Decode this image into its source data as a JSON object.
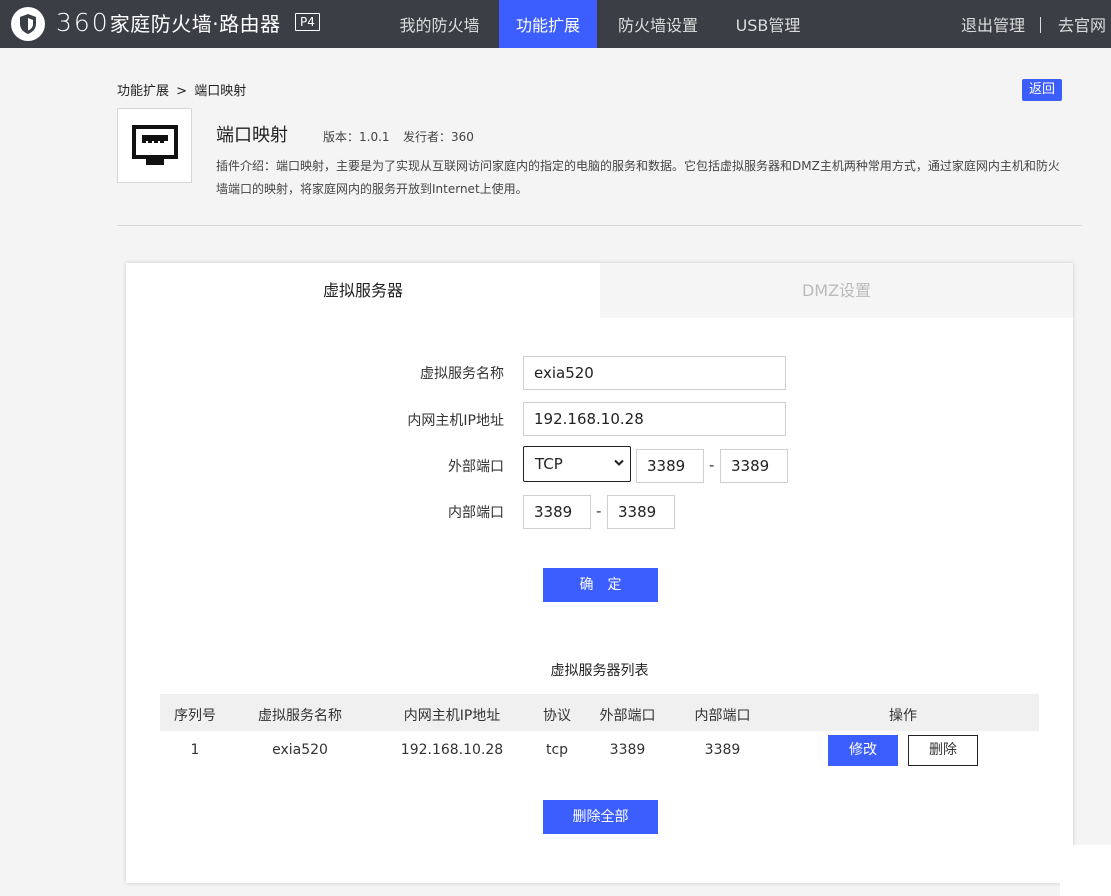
{
  "brand": {
    "number": "360",
    "title": "家庭防火墙·路由器",
    "badge": "P4"
  },
  "nav": {
    "items": [
      "我的防火墙",
      "功能扩展",
      "防火墙设置",
      "USB管理"
    ],
    "active_index": 1,
    "logout": "退出管理",
    "official": "去官网"
  },
  "breadcrumb": {
    "parent": "功能扩展",
    "sep": ">",
    "current": "端口映射"
  },
  "back_label": "返回",
  "plugin": {
    "name": "端口映射",
    "version": "版本：1.0.1",
    "publisher": "发行者：360",
    "description": "插件介绍：端口映射，主要是为了实现从互联网访问家庭内的指定的电脑的服务和数据。它包括虚拟服务器和DMZ主机两种常用方式，通过家庭网内主机和防火墙端口的映射，将家庭网内的服务开放到Internet上使用。"
  },
  "tabs": [
    "虚拟服务器",
    "DMZ设置"
  ],
  "form": {
    "name_label": "虚拟服务名称",
    "name_value": "exia520",
    "ip_label": "内网主机IP地址",
    "ip_value": "192.168.10.28",
    "ext_port_label": "外部端口",
    "protocol": "TCP",
    "ext_port_start": "3389",
    "ext_port_end": "3389",
    "int_port_label": "内部端口",
    "int_port_start": "3389",
    "int_port_end": "3389",
    "dash": "-",
    "confirm": "确　定"
  },
  "list": {
    "title": "虚拟服务器列表",
    "headers": [
      "序列号",
      "虚拟服务名称",
      "内网主机IP地址",
      "协议",
      "外部端口",
      "内部端口",
      "操作"
    ],
    "rows": [
      {
        "index": "1",
        "name": "exia520",
        "ip": "192.168.10.28",
        "protocol": "tcp",
        "ext_port": "3389",
        "int_port": "3389"
      }
    ],
    "edit": "修改",
    "delete": "删除",
    "delete_all": "删除全部"
  },
  "colors": {
    "topbar": "#3b3f45",
    "accent": "#3d5eff",
    "page_bg": "#f4f4f4"
  }
}
